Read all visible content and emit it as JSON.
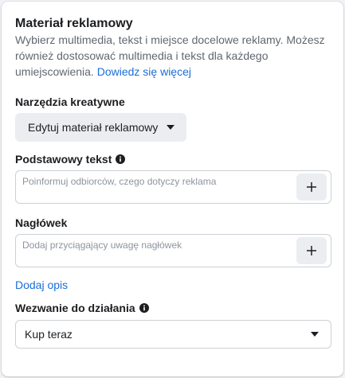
{
  "section": {
    "title": "Materiał reklamowy",
    "description": "Wybierz multimedia, tekst i miejsce docelowe reklamy. Możesz również dostosować multimedia i tekst dla każdego umiejscowienia. ",
    "learn_more": "Dowiedz się więcej"
  },
  "creative_tools": {
    "label": "Narzędzia kreatywne",
    "button_label": "Edytuj materiał reklamowy"
  },
  "primary_text": {
    "label": "Podstawowy tekst",
    "placeholder": "Poinformuj odbiorców, czego dotyczy reklama",
    "add_button": "+"
  },
  "headline": {
    "label": "Nagłówek",
    "placeholder": "Dodaj przyciągający uwagę nagłówek",
    "add_button": "+"
  },
  "add_description_link": "Dodaj opis",
  "cta": {
    "label": "Wezwanie do działania",
    "selected": "Kup teraz"
  },
  "icons": {
    "info": "info-icon",
    "caret": "caret-down-icon",
    "plus": "plus-icon"
  },
  "colors": {
    "link": "#1a6ed8",
    "text_primary": "#1c1e21",
    "text_secondary": "#606770",
    "button_bg": "#ebedf0",
    "border": "#ccd0d5"
  }
}
